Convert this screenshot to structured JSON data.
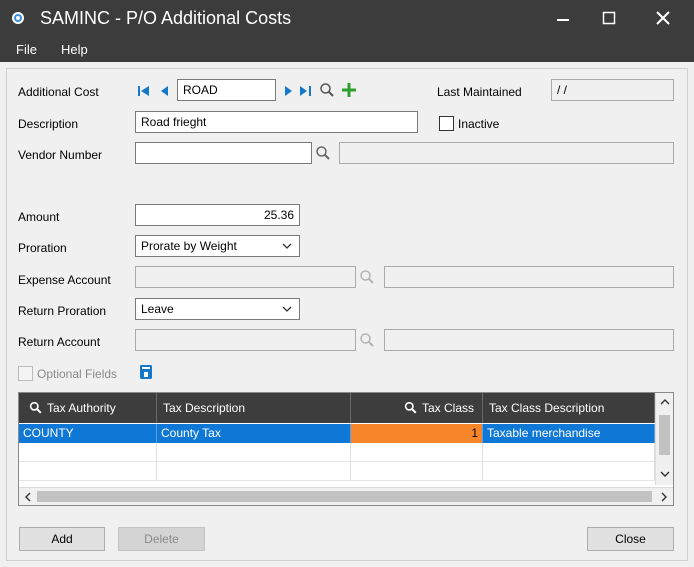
{
  "window": {
    "title": "SAMINC - P/O Additional Costs"
  },
  "menu": [
    "File",
    "Help"
  ],
  "form": {
    "additional_cost_label": "Additional Cost",
    "additional_cost_value": "ROAD",
    "last_maintained_label": "Last Maintained",
    "last_maintained_value": " /  /",
    "description_label": "Description",
    "description_value": "Road frieght",
    "inactive_label": "Inactive",
    "vendor_number_label": "Vendor Number",
    "vendor_number_value": "",
    "vendor_name_value": "",
    "amount_label": "Amount",
    "amount_value": "25.36",
    "proration_label": "Proration",
    "proration_value": "Prorate by Weight",
    "expense_account_label": "Expense Account",
    "expense_account_value": "",
    "expense_account_desc": "",
    "return_proration_label": "Return Proration",
    "return_proration_value": "Leave",
    "return_account_label": "Return Account",
    "return_account_value": "",
    "return_account_desc": "",
    "optional_fields_label": "Optional Fields"
  },
  "grid": {
    "columns": [
      "Tax Authority",
      "Tax Description",
      "Tax Class",
      "Tax Class Description"
    ],
    "rows": [
      {
        "tax_authority": "COUNTY",
        "tax_description": "County Tax",
        "tax_class": "1",
        "tax_class_description": "Taxable merchandise"
      }
    ]
  },
  "buttons": {
    "add": "Add",
    "delete": "Delete",
    "close": "Close"
  },
  "colors": {
    "titlebar": "#3c3c3c",
    "selection": "#0f78d7",
    "highlight_cell": "#f7862b",
    "nav_arrow": "#1479c9",
    "add_plus": "#2e9e2e"
  },
  "icons": [
    "app-icon",
    "minimize-icon",
    "maximize-icon",
    "close-icon",
    "first-record-icon",
    "previous-record-icon",
    "next-record-icon",
    "last-record-icon",
    "finder-icon",
    "new-record-icon",
    "chevron-down-icon",
    "optional-fields-icon"
  ]
}
